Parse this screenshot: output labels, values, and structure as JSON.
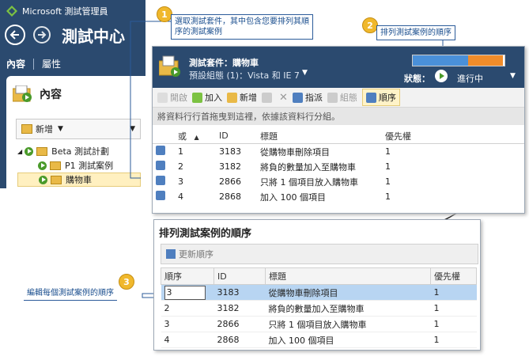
{
  "app": {
    "title": "Microsoft 測試管理員",
    "hub": "測試中心"
  },
  "tabs": [
    "內容",
    "屬性"
  ],
  "panel": {
    "heading": "內容",
    "new_label": "新增"
  },
  "tree": [
    {
      "label": "Beta 測試計劃",
      "level": 0
    },
    {
      "label": "P1 測試案例",
      "level": 1
    },
    {
      "label": "購物車",
      "level": 1,
      "selected": true
    }
  ],
  "suite": {
    "title": "測試套件：購物車",
    "config": "預設組態 (1)：Vista 和 IE 7",
    "state_label": "狀態：",
    "state_value": "進行中",
    "toolbar": [
      "開啟",
      "加入",
      "新增",
      "指派",
      "組態",
      "順序"
    ],
    "group_hint": "將資料行行首拖曳到這裡，依據該資料行分組。",
    "columns": [
      "或",
      "ID",
      "標題",
      "優先權"
    ],
    "rows": [
      {
        "order": "1",
        "id": "3183",
        "title": "從購物車刪除項目",
        "priority": "1"
      },
      {
        "order": "2",
        "id": "3182",
        "title": "將負的數量加入至購物車",
        "priority": "1"
      },
      {
        "order": "3",
        "id": "2866",
        "title": "只將 1 個項目放入購物車",
        "priority": "1"
      },
      {
        "order": "4",
        "id": "2868",
        "title": "加入 100 個項目",
        "priority": "1"
      }
    ]
  },
  "order_dialog": {
    "title": "排列測試案例的順序",
    "update_label": "更新順序",
    "columns": [
      "順序",
      "ID",
      "標題",
      "優先權"
    ],
    "rows": [
      {
        "order": "3",
        "id": "3183",
        "title": "從購物車刪除項目",
        "priority": "1"
      },
      {
        "order": "2",
        "id": "3182",
        "title": "將負的數量加入至購物車",
        "priority": "1"
      },
      {
        "order": "3",
        "id": "2866",
        "title": "只將 1 個項目放入購物車",
        "priority": "1"
      },
      {
        "order": "4",
        "id": "2868",
        "title": "加入 100 個項目",
        "priority": "1"
      }
    ]
  },
  "callouts": [
    {
      "num": "1",
      "text": "選取測試套件，其中包含您要排列其順序的測試案例"
    },
    {
      "num": "2",
      "text": "排列測試案例的順序"
    },
    {
      "num": "3",
      "text": "編輯每個測試案例的順序"
    }
  ],
  "colors": {
    "header": "#2b4a6f",
    "badge": "#f0b82c",
    "selection": "#b8d5f2"
  }
}
